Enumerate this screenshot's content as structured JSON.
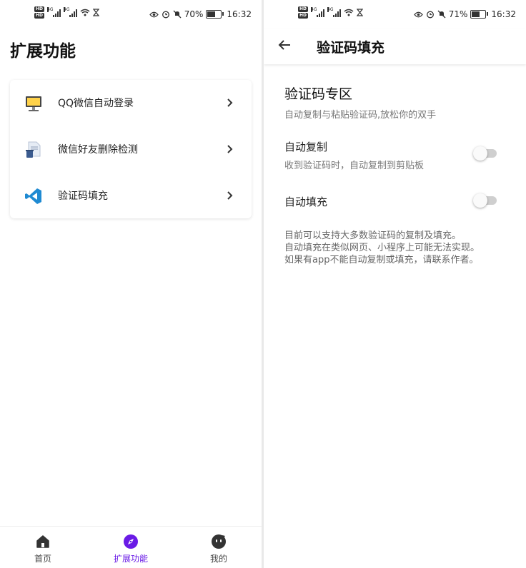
{
  "colors": {
    "accent": "#6a1be6",
    "vscode_blue": "#1f8ad2"
  },
  "left": {
    "status_bar": {
      "battery": "70%",
      "time": "16:32",
      "battery_fraction": 0.7
    },
    "page_title": "扩展功能",
    "menu": [
      {
        "label": "QQ微信自动登录",
        "icon": "monitor-icon"
      },
      {
        "label": "微信好友删除检测",
        "icon": "document-trash-icon"
      },
      {
        "label": "验证码填充",
        "icon": "vscode-icon"
      }
    ],
    "bottom_nav": [
      {
        "label": "首页",
        "icon": "home-icon",
        "active": false
      },
      {
        "label": "扩展功能",
        "icon": "compass-icon",
        "active": true
      },
      {
        "label": "我的",
        "icon": "profile-face-icon",
        "active": false
      }
    ]
  },
  "right": {
    "status_bar": {
      "battery": "71%",
      "time": "16:32",
      "battery_fraction": 0.71
    },
    "app_bar_title": "验证码填充",
    "section_title": "验证码专区",
    "section_subtitle": "自动复制与粘贴验证码,放松你的双手",
    "settings": [
      {
        "title": "自动复制",
        "subtitle": "收到验证码时，自动复制到剪贴板",
        "enabled": false
      },
      {
        "title": "自动填充",
        "subtitle": "",
        "enabled": false
      }
    ],
    "info_lines": [
      "目前可以支持大多数验证码的复制及填充。",
      "自动填充在类似网页、小程序上可能无法实现。",
      "如果有app不能自动复制或填充，请联系作者。"
    ]
  }
}
